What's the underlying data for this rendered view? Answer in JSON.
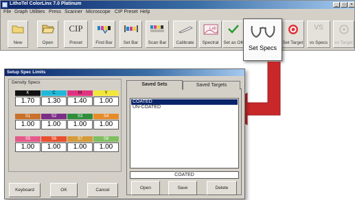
{
  "app": {
    "title": "LithoTel ColorLinx 7.0 Platinum",
    "window_controls": [
      "_",
      "□",
      "×"
    ]
  },
  "menu": [
    "File",
    "Graph",
    "Utilities",
    "Press",
    "Scanner",
    "Microscope",
    "CIP Preset",
    "Help"
  ],
  "toolbar": {
    "buttons": [
      {
        "label": "New",
        "icon": "folder-icon"
      },
      {
        "label": "Open",
        "icon": "open-folder-icon"
      },
      {
        "label": "Preset",
        "icon": "cip-icon",
        "icon_text": "CIP"
      },
      {
        "label": "Find Bar",
        "icon": "find-bar-icon"
      },
      {
        "label": "Set Bar",
        "icon": "set-bar-icon"
      },
      {
        "label": "Scan Bar",
        "icon": "scan-bar-icon"
      },
      {
        "label": "Calibrate",
        "icon": "calibrate-icon"
      },
      {
        "label": "Spectral",
        "icon": "spectral-icon",
        "icon_text": "Lab"
      },
      {
        "label": "Set as OK",
        "icon": "checkmark-icon"
      },
      {
        "label": "Set Target",
        "icon": "target-icon"
      },
      {
        "label": "vs Specs",
        "icon": "vs-specs-icon",
        "icon_text": "VS"
      },
      {
        "label": "vs Target",
        "icon": "vs-target-icon"
      }
    ]
  },
  "tooltip": {
    "label": "Set Specs",
    "icon": "spectacles-icon"
  },
  "colors": {
    "arrow": "#c8282a",
    "title_bar": "#0a246a",
    "selection": "#0a246a"
  },
  "dialog": {
    "title": "Setup Spec Limits",
    "density_group_label": "Density Specs",
    "rows": [
      {
        "swatches": [
          {
            "label": "K",
            "color": "#111111",
            "text": "#ffffff"
          },
          {
            "label": "C",
            "color": "#21b8d8",
            "text": "#000000"
          },
          {
            "label": "M",
            "color": "#e0337f",
            "text": "#000000"
          },
          {
            "label": "Y",
            "color": "#f2e63c",
            "text": "#000000"
          }
        ],
        "values": [
          "1.70",
          "1.30",
          "1.40",
          "1.00"
        ]
      },
      {
        "swatches": [
          {
            "label": "S1",
            "color": "#c9702b",
            "text": "#ffffff"
          },
          {
            "label": "S2",
            "color": "#7b2e86",
            "text": "#ffffff"
          },
          {
            "label": "S3",
            "color": "#2f8e3b",
            "text": "#ffffff"
          },
          {
            "label": "S4",
            "color": "#e58b2a",
            "text": "#ffffff"
          }
        ],
        "values": [
          "1.00",
          "1.00",
          "1.00",
          "1.00"
        ]
      },
      {
        "swatches": [
          {
            "label": "S5",
            "color": "#e65a8a",
            "text": "#ffffff"
          },
          {
            "label": "S6",
            "color": "#e8502f",
            "text": "#ffffff"
          },
          {
            "label": "S7",
            "color": "#d59a3a",
            "text": "#ffffff"
          },
          {
            "label": "S8",
            "color": "#7fbf62",
            "text": "#ffffff"
          }
        ],
        "values": [
          "1.00",
          "1.00",
          "1.00",
          "1.00"
        ]
      }
    ],
    "buttons": {
      "keyboard": "Keyboard",
      "ok": "OK",
      "cancel": "Cancel",
      "open": "Open",
      "save": "Save",
      "delete": "Delete"
    },
    "tabs": {
      "active": "Saved Sets",
      "inactive": "Saved Targets"
    },
    "sets_list": [
      {
        "label": "COATED",
        "selected": true
      },
      {
        "label": "UN-COATED",
        "selected": false
      }
    ],
    "set_name_value": "COATED"
  }
}
